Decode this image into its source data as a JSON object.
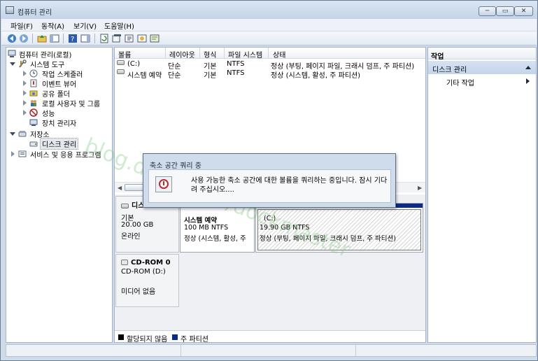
{
  "window": {
    "title": "컴퓨터 관리",
    "buttons": [
      "─",
      "▭",
      "✕"
    ]
  },
  "menu": [
    "파일(F)",
    "동작(A)",
    "보기(V)",
    "도움말(H)"
  ],
  "toolbar": [
    "back-icon",
    "forward-icon",
    "up-folder-icon",
    "show-hide-tree-icon",
    "help-icon",
    "action-pane-icon",
    "refresh-icon",
    "properties-icon",
    "export-icon",
    "help-topic-icon",
    "console-icon"
  ],
  "tree": {
    "root": "컴퓨터 관리(로컬)",
    "system_tools": "시스템 도구",
    "task_scheduler": "작업 스케줄러",
    "event_viewer": "이벤트 뷰어",
    "shared_folders": "공유 폴더",
    "local_users": "로컬 사용자 및 그룹",
    "performance": "성능",
    "device_manager": "장치 관리자",
    "storage": "저장소",
    "disk_management": "디스크 관리",
    "services_apps": "서비스 및 응용 프로그램"
  },
  "volumes": {
    "columns": [
      "볼륨",
      "레이아웃",
      "형식",
      "파일 시스템",
      "상태"
    ],
    "rows": [
      {
        "name": "(C:)",
        "layout": "단순",
        "type": "기본",
        "fs": "NTFS",
        "status": "정상 (부팅, 페이지 파일, 크래시 덤프, 주 파티션)"
      },
      {
        "name": "시스템 예약",
        "layout": "단순",
        "type": "기본",
        "fs": "NTFS",
        "status": "정상 (시스템, 활성, 주 파티션)"
      }
    ]
  },
  "disks": {
    "disk0": {
      "name": "디스크 0",
      "type": "기본",
      "size": "20.00 GB",
      "state": "온라인"
    },
    "part_reserved": {
      "name": "시스템 예약",
      "size": "100 MB NTFS",
      "status": "정상 (시스템, 활성, 주"
    },
    "part_c": {
      "name": "(C:)",
      "size": "19.90 GB NTFS",
      "status": "정상 (부팅, 페이지 파일, 크래시 덤프, 주 파티션)"
    },
    "cdrom": {
      "name": "CD-ROM 0",
      "drive": "CD-ROM (D:)",
      "state": "미디어 없음"
    }
  },
  "legend": {
    "unallocated": "할당되지 않음",
    "primary": "주 파티션",
    "colors": {
      "unallocated": "#000000",
      "primary": "#0b2a8a"
    }
  },
  "actions": {
    "header": "작업",
    "section": "디스크 관리",
    "more": "기타 작업"
  },
  "dialog": {
    "title": "축소 공간 쿼리 중",
    "message": "사용 가능한 축소 공간에 대한 볼륨을 쿼리하는 중입니다. 잠시 기다려 주십시오...."
  },
  "watermark": "blog.daum.net/dockmaster"
}
